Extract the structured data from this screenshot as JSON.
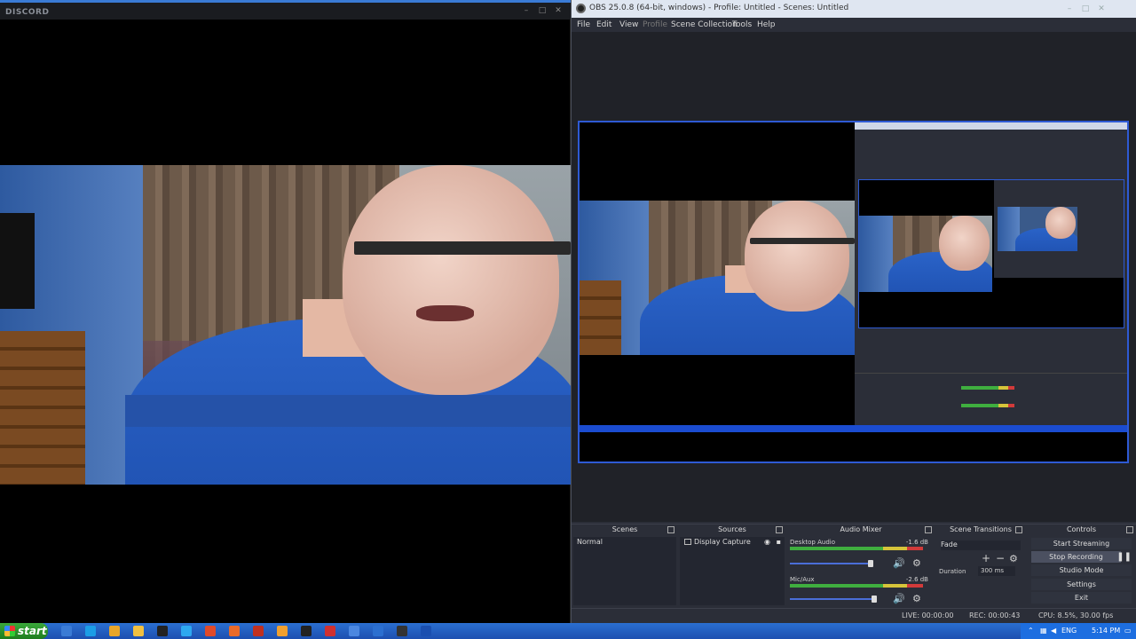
{
  "discord": {
    "title": "DISCORD",
    "controls": [
      "–",
      "□",
      "✕"
    ]
  },
  "obs": {
    "title": "OBS 25.0.8 (64-bit, windows) - Profile: Untitled - Scenes: Untitled",
    "menu": [
      "File",
      "Edit",
      "View",
      "Profile",
      "Scene Collection",
      "Tools",
      "Help"
    ],
    "docks": {
      "scenes": {
        "title": "Scenes",
        "items": [
          "Normal"
        ]
      },
      "sources": {
        "title": "Sources",
        "items": [
          "Display Capture"
        ]
      },
      "mixer": {
        "title": "Audio Mixer",
        "channels": [
          {
            "name": "Desktop Audio",
            "db": "-1.6 dB"
          },
          {
            "name": "Mic/Aux",
            "db": "-2.6 dB"
          }
        ]
      },
      "transitions": {
        "title": "Scene Transitions",
        "type": "Fade",
        "duration_label": "Duration",
        "duration_value": "300 ms"
      },
      "controls": {
        "title": "Controls",
        "buttons": [
          "Start Streaming",
          "Stop Recording",
          "Studio Mode",
          "Settings",
          "Exit"
        ]
      }
    },
    "status": {
      "live": "LIVE: 00:00:00",
      "rec": "REC: 00:00:43",
      "cpu": "CPU: 8.5%, 30.00 fps"
    }
  },
  "taskbar": {
    "start_label": "start",
    "tray": {
      "lang": "ENG",
      "time": "5:14 PM"
    },
    "icon_colors": [
      "#3a7bd5",
      "#1b9de6",
      "#e8a62a",
      "#f0c040",
      "#222222",
      "#2da8f0",
      "#e04a2a",
      "#e86a2a",
      "#c03020",
      "#f0a030",
      "#222222",
      "#d03030",
      "#4b87e0",
      "#2b6fd0",
      "#333333",
      "#1a4fb0"
    ]
  }
}
